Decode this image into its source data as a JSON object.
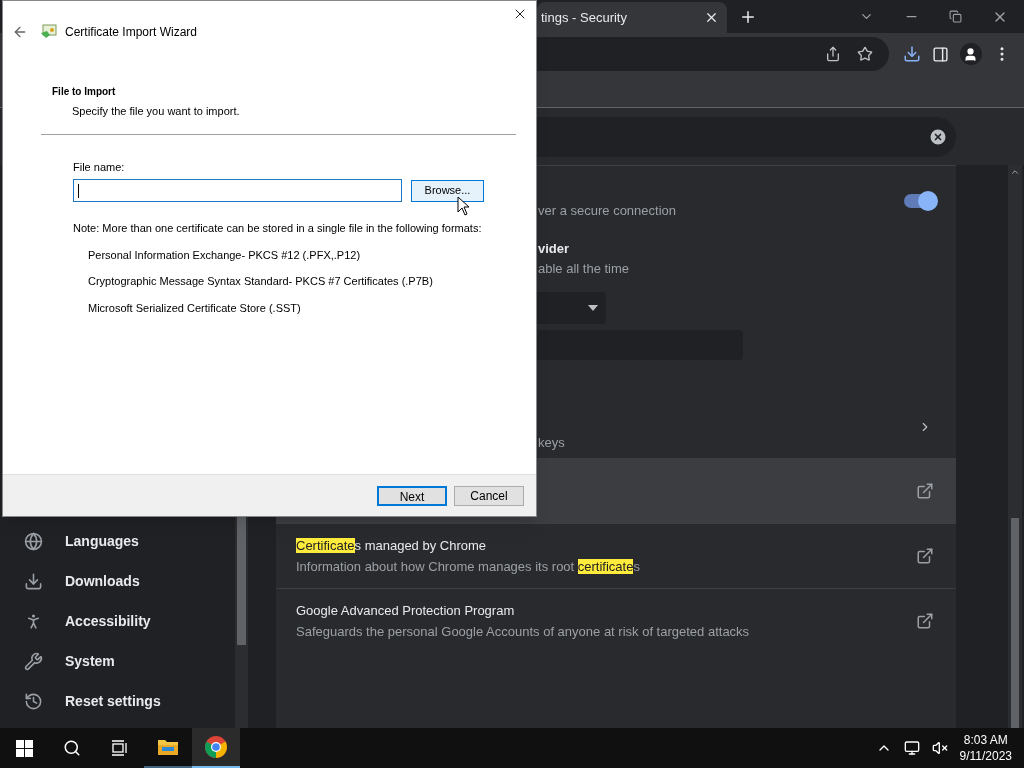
{
  "browser": {
    "tab": {
      "title": "tings - Security",
      "selected": true
    },
    "sidebar": {
      "items": [
        {
          "kind": "globe",
          "label": "Languages"
        },
        {
          "kind": "download",
          "label": "Downloads"
        },
        {
          "kind": "accessibility",
          "label": "Accessibility"
        },
        {
          "kind": "wrench",
          "label": "System"
        },
        {
          "kind": "history",
          "label": "Reset settings"
        }
      ]
    },
    "rows": [
      {
        "kind": "toggle",
        "subtitle": "ver a secure connection",
        "on": true
      },
      {
        "kind": "text",
        "title": "vider",
        "subtitle": "able all the time"
      },
      {
        "kind": "select"
      },
      {
        "kind": "field"
      },
      {
        "kind": "chevron",
        "subtitle": "keys"
      },
      {
        "kind": "external",
        "hovered": true
      },
      {
        "kind": "external",
        "hovered": false,
        "title": [
          {
            "text": "Certificate",
            "highlight": true
          },
          {
            "text": "s managed by Chrome",
            "highlight": false
          }
        ],
        "subtitle": [
          {
            "text": "Information about how Chrome manages its root ",
            "highlight": false
          },
          {
            "text": "certificate",
            "highlight": true
          },
          {
            "text": "s",
            "highlight": false
          }
        ]
      },
      {
        "kind": "external",
        "hovered": false,
        "title": [
          {
            "text": "Google Advanced Protection Program",
            "highlight": false
          }
        ],
        "subtitle": [
          {
            "text": "Safeguards the personal Google Accounts of anyone at risk of targeted attacks",
            "highlight": false
          }
        ]
      }
    ]
  },
  "dialog": {
    "title": "Certificate Import Wizard",
    "heading": "File to Import",
    "subheading": "Specify the file you want to import.",
    "file_label": "File name:",
    "browse_label": "Browse...",
    "note": "Note:  More than one certificate can be stored in a single file in the following formats:",
    "formats": [
      "Personal Information Exchange- PKCS #12 (.PFX,.P12)",
      "Cryptographic Message Syntax Standard- PKCS #7 Certificates (.P7B)",
      "Microsoft Serialized Certificate Store (.SST)"
    ],
    "buttons": [
      {
        "label": "Next",
        "default": true
      },
      {
        "label": "Cancel",
        "default": false
      }
    ]
  },
  "taskbar": {
    "apps": [
      {
        "kind": "explorer",
        "selected": false
      },
      {
        "kind": "chrome",
        "selected": true
      }
    ],
    "time": "8:03 AM",
    "date": "9/11/2023"
  }
}
